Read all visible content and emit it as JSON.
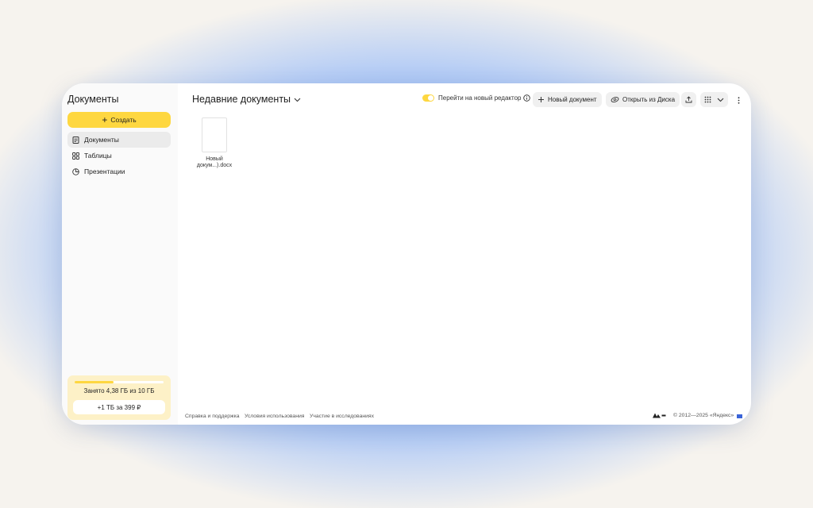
{
  "sidebar": {
    "app_title": "Документы",
    "create_label": "Создать",
    "items": [
      {
        "label": "Документы",
        "icon": "document-icon",
        "active": true
      },
      {
        "label": "Таблицы",
        "icon": "grid-icon",
        "active": false
      },
      {
        "label": "Презентации",
        "icon": "presentation-icon",
        "active": false
      }
    ],
    "storage": {
      "used_text": "Занято 4,38 ГБ из 10 ГБ",
      "used_fraction": 0.438,
      "upgrade_label": "+1 ТБ за 399 ₽"
    }
  },
  "header": {
    "title": "Недавние документы",
    "toggle_label": "Перейти на новый редактор",
    "toggle_on": true,
    "new_doc_label": "Новый документ",
    "open_disk_label": "Открыть из Диска"
  },
  "files": [
    {
      "name_line1": "Новый",
      "name_line2": "докум...).docx"
    }
  ],
  "footer": {
    "links": [
      "Справка и поддержка",
      "Условия использования",
      "Участие в исследованиях"
    ],
    "copyright": "© 2012—2025 «Яндекс»"
  },
  "colors": {
    "accent_yellow": "#fed740",
    "storage_bg": "#fdf1c7",
    "background_glow": "#6f9ff0"
  }
}
